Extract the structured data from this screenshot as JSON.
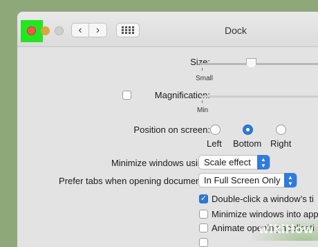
{
  "window": {
    "title": "Dock"
  },
  "toolbar": {
    "back": "‹",
    "forward": "›"
  },
  "size": {
    "label": "Size:",
    "min_label": "Small",
    "value": 0.3
  },
  "magnification": {
    "label": "Magnification:",
    "checked": false,
    "min_label": "Min"
  },
  "position": {
    "label": "Position on screen:",
    "options": [
      "Left",
      "Bottom",
      "Right"
    ],
    "selected": "Bottom"
  },
  "minimize": {
    "label": "Minimize windows using:",
    "value": "Scale effect"
  },
  "tabs": {
    "label": "Prefer tabs when opening documents:",
    "value": "In Full Screen Only"
  },
  "checkboxes": [
    {
      "label": "Double-click a window’s ti",
      "checked": true
    },
    {
      "label": "Minimize windows into app",
      "checked": false
    },
    {
      "label": "Animate opening applicati",
      "checked": false
    }
  ],
  "watermark": {
    "text": "wikiHow"
  },
  "colors": {
    "accent": "#2e78d6",
    "highlight": "#22e622",
    "close": "#f2574f"
  }
}
